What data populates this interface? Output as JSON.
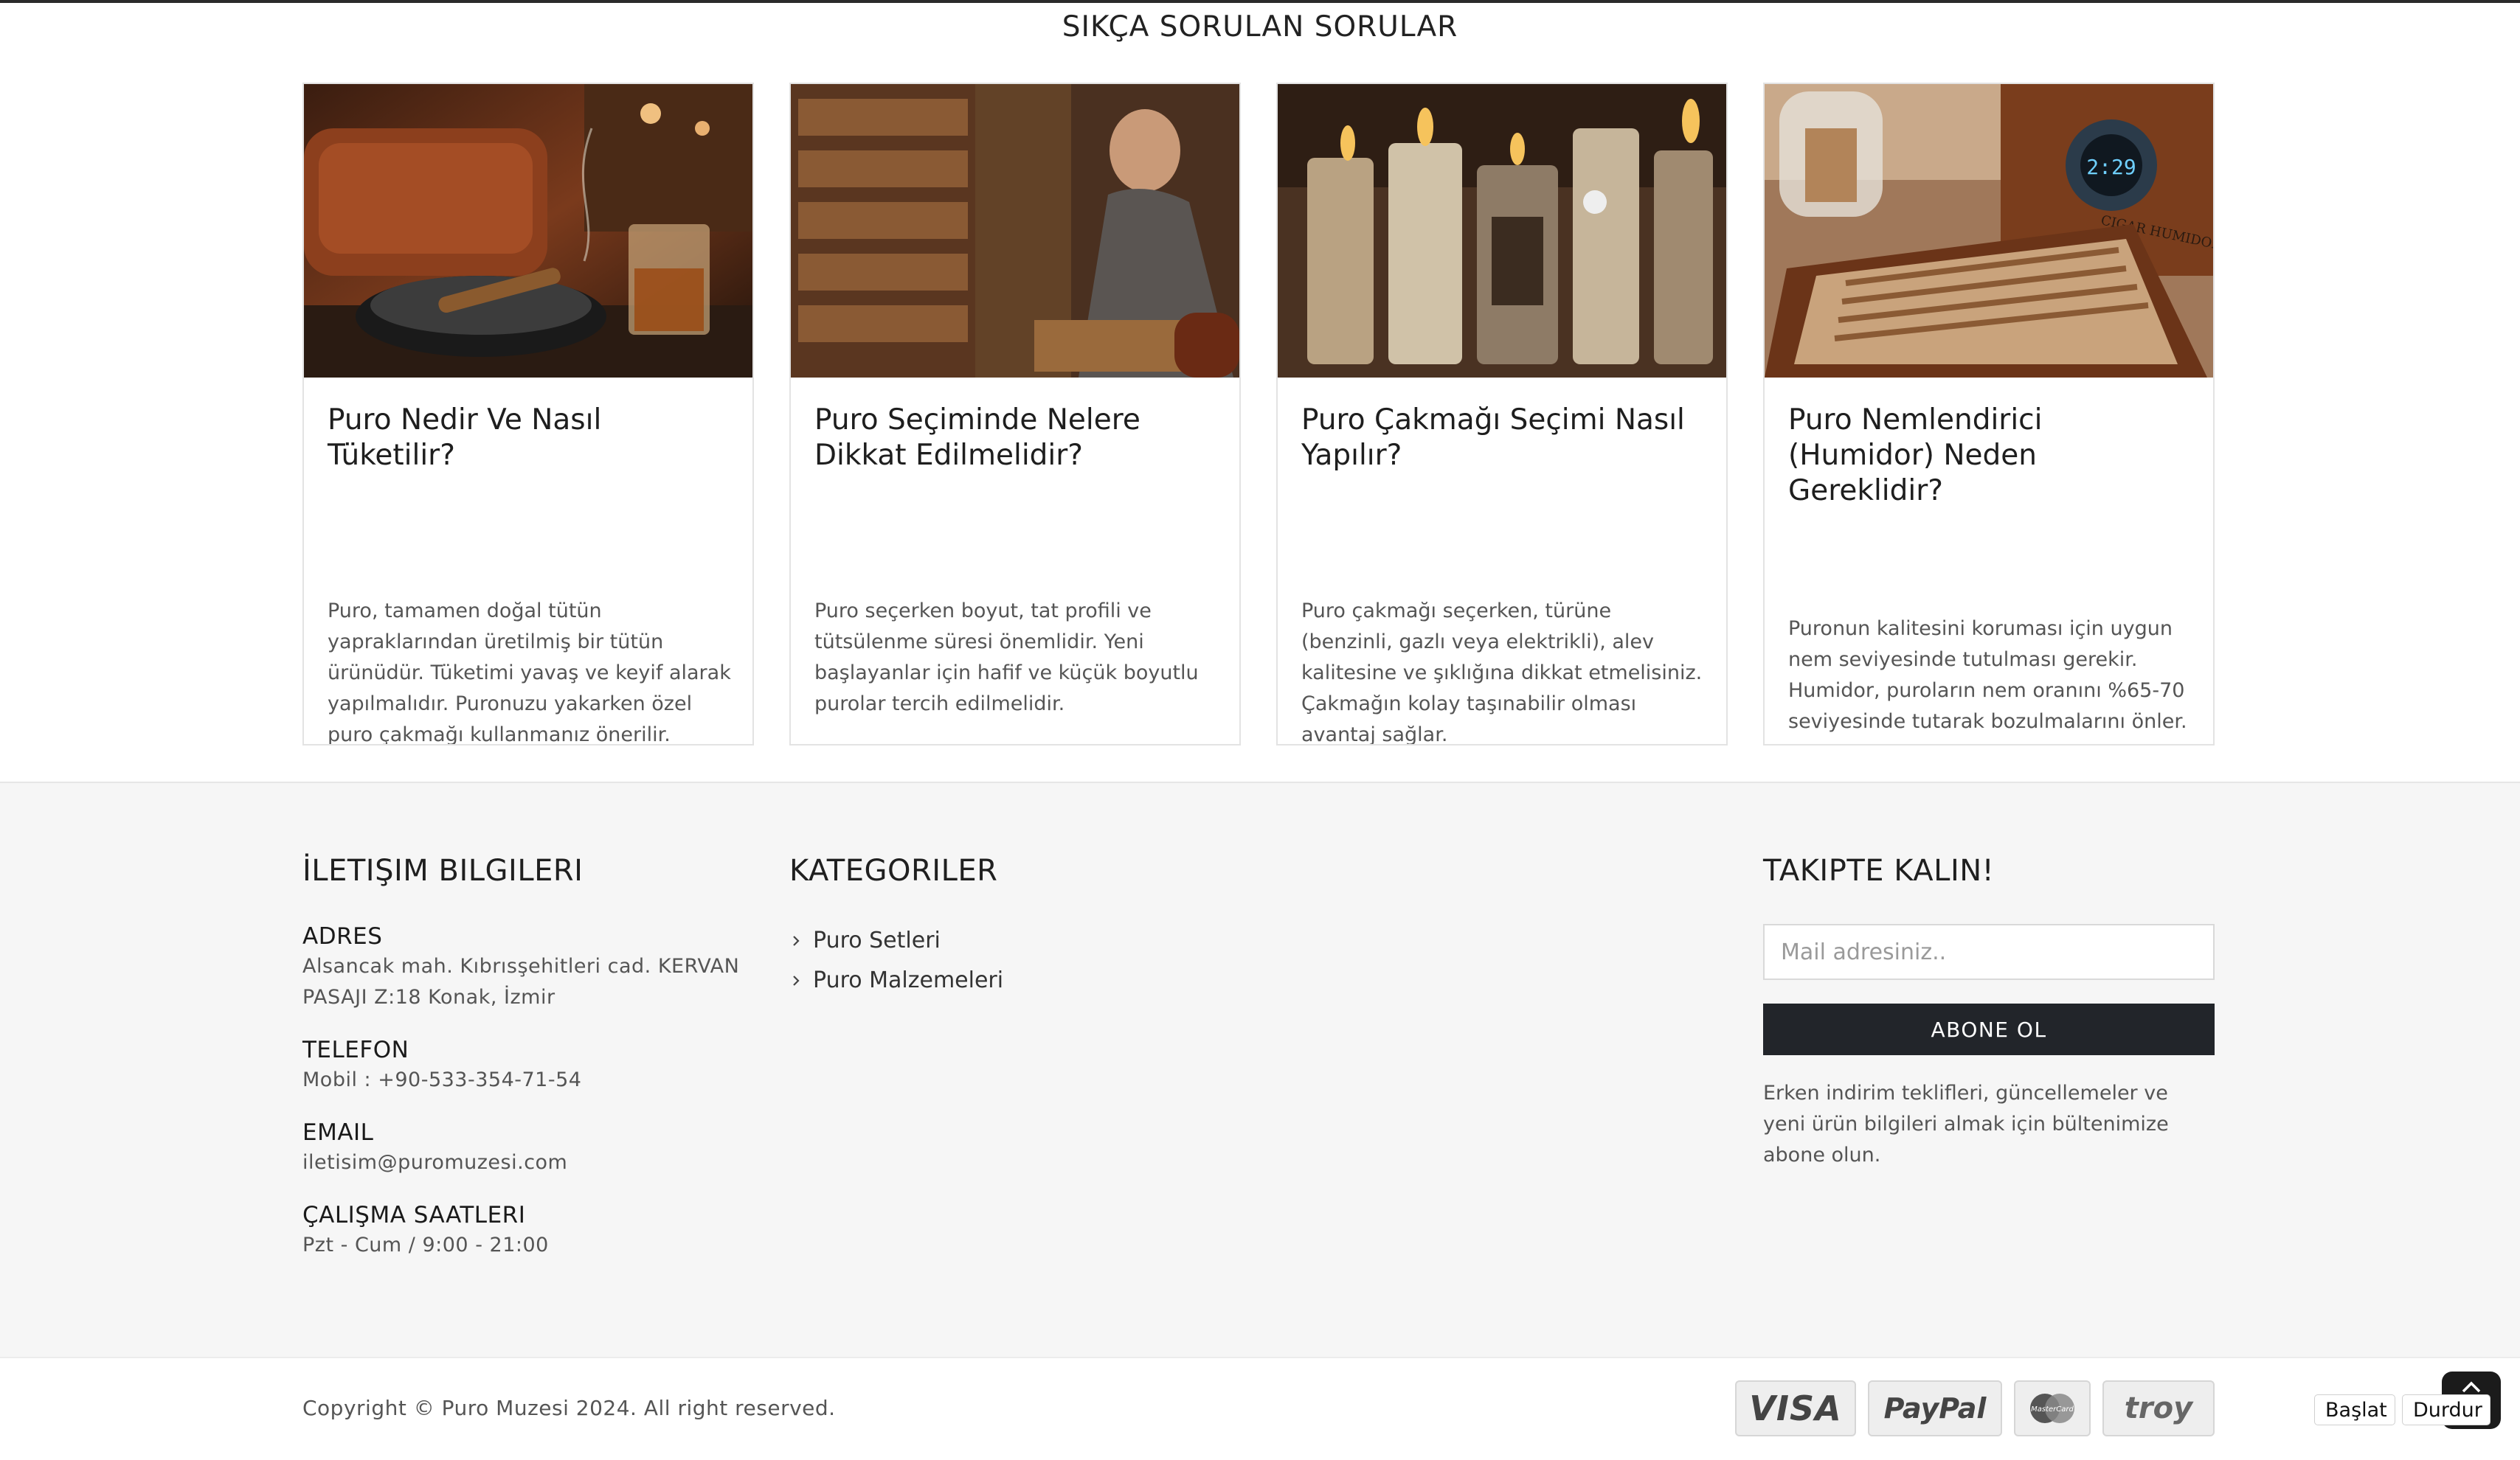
{
  "faq": {
    "title": "SIKÇA SORULAN SORULAR",
    "cards": [
      {
        "title": "Puro Nedir Ve Nasıl Tüketilir?",
        "text": "Puro, tamamen doğal tütün yapraklarından üretilmiş bir tütün ürünüdür. Tüketimi yavaş ve keyif alarak yapılmalıdır. Puronuzu yakarken özel puro çakmağı kullanmanız önerilir.",
        "image": "cigar-lounge-image"
      },
      {
        "title": "Puro Seçiminde Nelere Dikkat Edilmelidir?",
        "text": "Puro seçerken boyut, tat profili ve tütsülenme süresi önemlidir. Yeni başlayanlar için hafif ve küçük boyutlu purolar tercih edilmelidir.",
        "image": "cigar-shop-image"
      },
      {
        "title": "Puro Çakmağı Seçimi Nasıl Yapılır?",
        "text": "Puro çakmağı seçerken, türüne (benzinli, gazlı veya elektrikli), alev kalitesine ve şıklığına dikkat etmelisiniz. Çakmağın kolay taşınabilir olması avantaj sağlar.",
        "image": "lighters-image"
      },
      {
        "title": "Puro Nemlendirici (Humidor) Neden Gereklidir?",
        "text": "Puronun kalitesini koruması için uygun nem seviyesinde tutulması gerekir. Humidor, puroların nem oranını %65-70 seviyesinde tutarak bozulmalarını önler.",
        "image": "humidor-image",
        "image_label": "CIGAR HUMIDOR",
        "display_reading": "2:29"
      }
    ]
  },
  "contact": {
    "heading": "İLETIŞIM BILGILERI",
    "address_label": "ADRES",
    "address_line1": "Alsancak mah. Kıbrısşehitleri cad. KERVAN",
    "address_line2": "PASAJI Z:18 Konak, İzmir",
    "phone_label": "TELEFON",
    "phone": "Mobil : +90-533-354-71-54",
    "email_label": "EMAIL",
    "email": "iletisim@puromuzesi.com",
    "hours_label": "ÇALIŞMA SAATLERI",
    "hours": "Pzt - Cum / 9:00 - 21:00"
  },
  "categories": {
    "heading": "KATEGORILER",
    "items": [
      "Puro Setleri",
      "Puro Malzemeleri"
    ]
  },
  "newsletter": {
    "heading": "TAKIPTE KALIN!",
    "placeholder": "Mail adresiniz..",
    "button": "ABONE OL",
    "note_line1": "Erken indirim teklifleri, güncellemeler ve",
    "note_line2": "yeni ürün bilgileri almak için bültenimize",
    "note_line3": "abone olun."
  },
  "bottom": {
    "copyright": "Copyright © Puro Muzesi 2024. All right reserved.",
    "payments": [
      "VISA",
      "PayPal",
      "MasterCard",
      "troy"
    ]
  },
  "controls": {
    "start": "Başlat",
    "stop": "Durdur"
  },
  "colors": {
    "accent_dark": "#22252a",
    "footer_bg": "#f6f6f6"
  }
}
